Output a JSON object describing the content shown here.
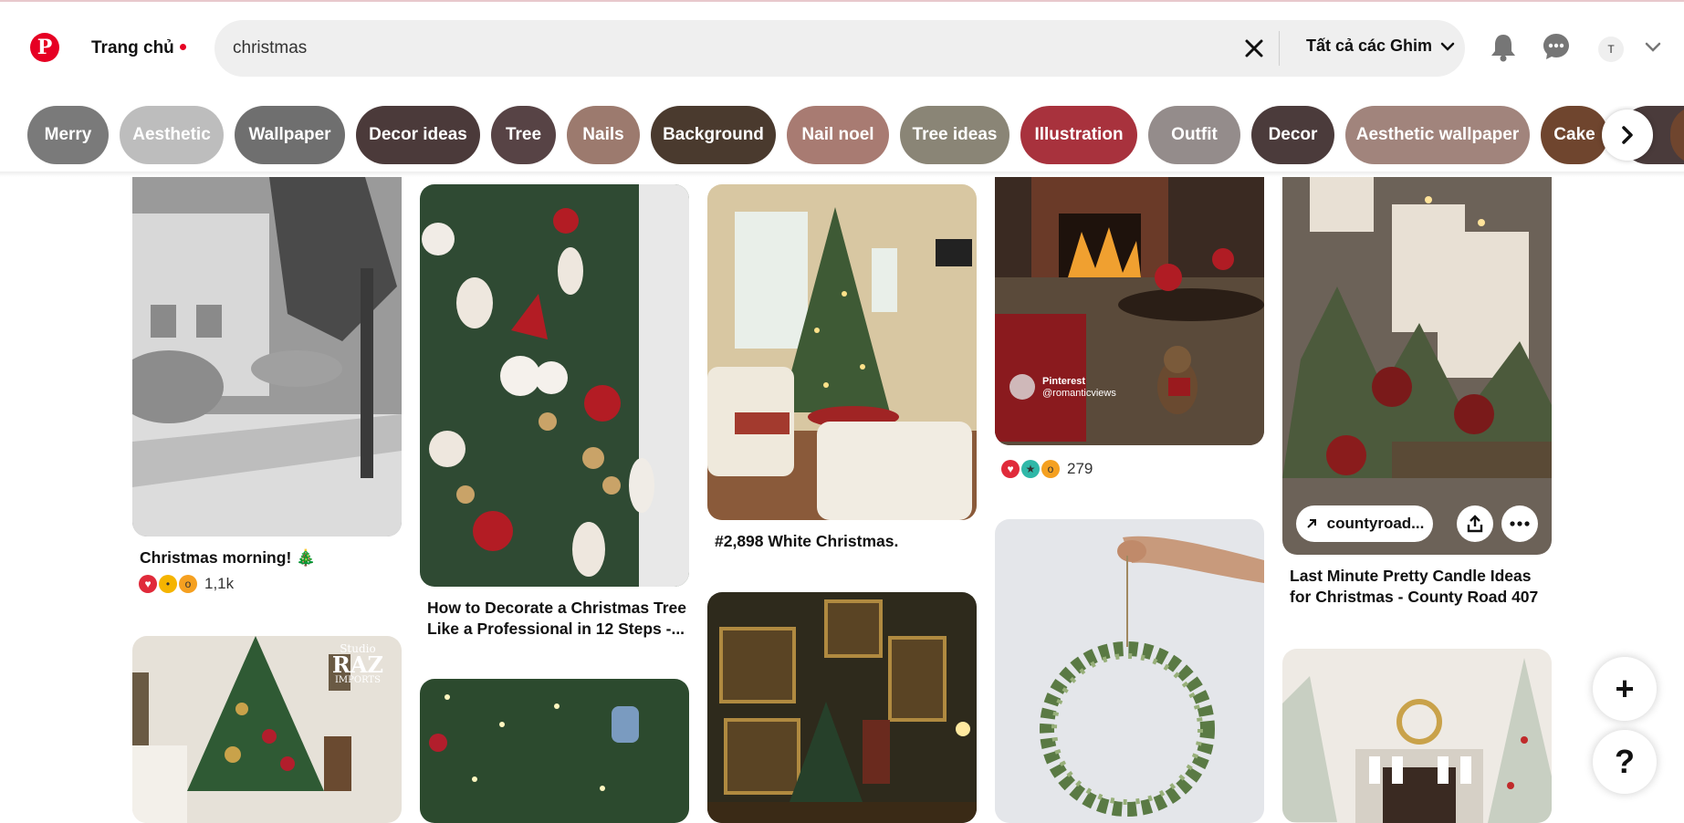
{
  "header": {
    "home_label": "Trang chủ",
    "search_value": "christmas",
    "filter_label": "Tất cả các Ghim",
    "avatar_initial": "T"
  },
  "chips": [
    {
      "label": "Merry",
      "color": "#7a7a7a"
    },
    {
      "label": "Aesthetic",
      "color": "#bdbdbd"
    },
    {
      "label": "Wallpaper",
      "color": "#6f6f6f"
    },
    {
      "label": "Decor ideas",
      "color": "#4b3a3a"
    },
    {
      "label": "Tree",
      "color": "#574345"
    },
    {
      "label": "Nails",
      "color": "#9c7a6e"
    },
    {
      "label": "Background",
      "color": "#4a3a2e"
    },
    {
      "label": "Nail noel",
      "color": "#a87b72"
    },
    {
      "label": "Tree ideas",
      "color": "#8a8576"
    },
    {
      "label": "Illustration",
      "color": "#a8323d"
    },
    {
      "label": "Outfit",
      "color": "#948c8b"
    },
    {
      "label": "Decor",
      "color": "#4b3b3b"
    },
    {
      "label": "Aesthetic wallpaper",
      "color": "#a1847c"
    },
    {
      "label": "Cake",
      "color": "#6f452e"
    }
  ],
  "pins": {
    "p1": {
      "title": "Christmas morning! 🎄",
      "reactions": "1,1k"
    },
    "p2": {
      "title": "How to Decorate a Christmas Tree Like a Professional in 12 Steps -..."
    },
    "p3": {
      "title": "#2,898 White Christmas."
    },
    "p4": {
      "reactions": "279",
      "watermark_line1": "Pinterest",
      "watermark_line2": "@romanticviews"
    },
    "p5": {
      "title": "Last Minute Pretty Candle Ideas for Christmas - County Road 407",
      "link_label": "countyroad..."
    },
    "p6": {
      "watermark_line1": "Studio",
      "watermark_line2": "RAZ",
      "watermark_line3": "IMPORTS"
    }
  },
  "fabs": {
    "plus": "+",
    "help": "?"
  },
  "colors": {
    "brand": "#e60023"
  }
}
